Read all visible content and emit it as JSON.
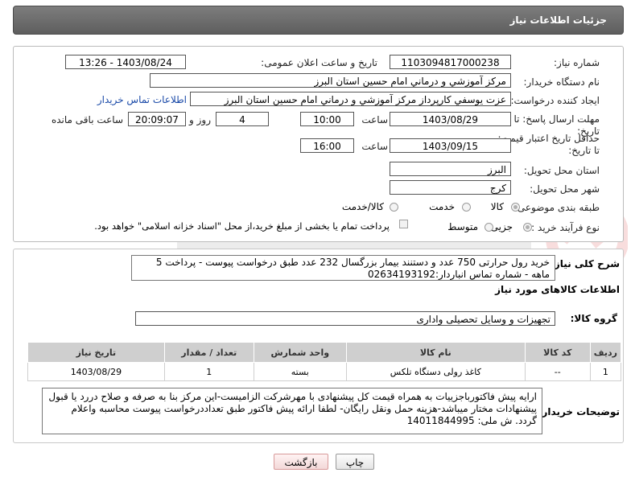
{
  "panel": {
    "title": "جزئیات اطلاعات نیاز"
  },
  "form": {
    "need_number_label": "شماره نیاز:",
    "need_number": "1103094817000238",
    "announce_label": "تاریخ و ساعت اعلان عمومی:",
    "announce_value": "1403/08/24 - 13:26",
    "buyer_org_label": "نام دستگاه خریدار:",
    "buyer_org": "مرکز آموزشي و درماني امام حسين استان البرز",
    "creator_label": "ایجاد کننده درخواست:",
    "creator": "عزت يوسفي کارپرداز مرکز آموزشي و درماني امام حسين استان البرز",
    "buyer_contact_link": "اطلاعات تماس خریدار",
    "deadline_label": "مهلت ارسال پاسخ: تا تاریخ:",
    "deadline_date": "1403/08/29",
    "time_word": "ساعت",
    "deadline_time": "10:00",
    "days_value": "4",
    "days_and": "روز و",
    "remaining_time": "20:09:07",
    "remaining_label": "ساعت باقی مانده",
    "validity_label": "حداقل تاریخ اعتبار قیمت: تا تاریخ:",
    "validity_date": "1403/09/15",
    "validity_time": "16:00",
    "province_label": "استان محل تحویل:",
    "province": "البرز",
    "city_label": "شهر محل تحویل:",
    "city": "کرج",
    "category_label": "طبقه بندی موضوعی:",
    "category_options": [
      "کالا",
      "خدمت",
      "کالا/خدمت"
    ],
    "purchase_type_label": "نوع فرآیند خرید :",
    "purchase_options": [
      "جزیی",
      "متوسط"
    ],
    "payment_note": "پرداخت تمام یا بخشی از مبلغ خرید،از محل \"اسناد خزانه اسلامی\" خواهد بود."
  },
  "summary": {
    "label": "شرح کلی نیاز:",
    "text": "خرید رول حرارتی 750 عدد و دستنند بیمار بزرگسال 232 عدد طبق درخواست پیوست - پرداخت 5 ماهه - شماره تماس انباردار:02634193192"
  },
  "goods": {
    "section_title": "اطلاعات کالاهای مورد نیاز",
    "group_label": "گروه کالا:",
    "group_value": "تجهیزات و وسایل تحصیلی واداری",
    "columns": [
      "ردیف",
      "کد کالا",
      "نام کالا",
      "واحد شمارش",
      "تعداد / مقدار",
      "تاریخ نیاز"
    ],
    "rows": [
      {
        "index": "1",
        "code": "--",
        "name": "کاغذ رولی دستگاه تلکس",
        "unit": "بسته",
        "qty": "1",
        "date": "1403/08/29"
      }
    ]
  },
  "buyer_notes": {
    "label": "توضیحات خریدار:",
    "text": "ارایه پیش فاکتورباجزییات به همراه قیمت کل پیشنهادی با مهرشرکت الزامیست-این مرکز بنا به صرفه و صلاح دررد یا قبول پیشنهادات مختار میباشد-هزینه حمل ونقل رایگان- لطفا ارائه پیش فاکتور طبق تعداددرخواست پیوست محاسبه واعلام گردد. ش ملی: 14011844995"
  },
  "buttons": {
    "print": "چاپ",
    "back": "بازگشت"
  },
  "colors": {
    "header": "#6e6e6e",
    "link": "#1a4aa8",
    "table_header": "#cfcfcf"
  }
}
